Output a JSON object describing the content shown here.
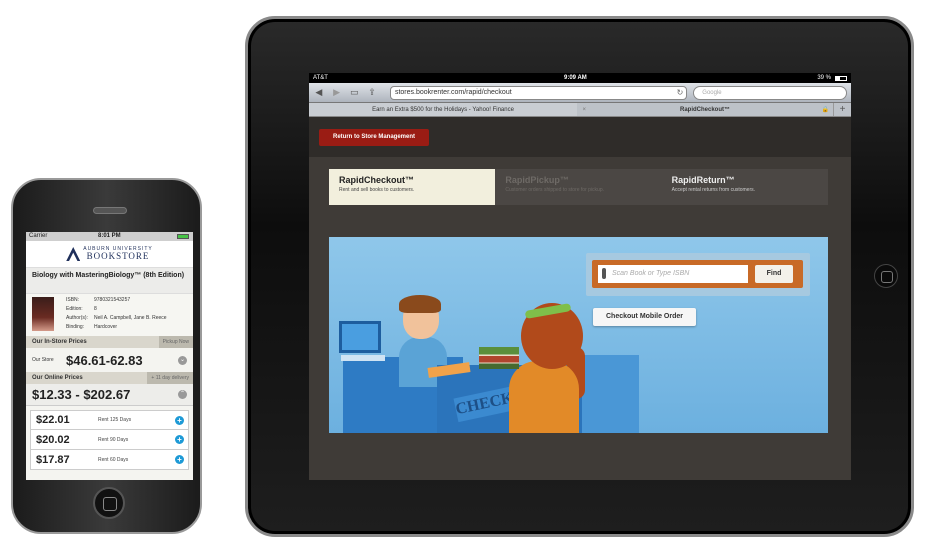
{
  "iphone": {
    "status": {
      "carrier": "Carrier",
      "time": "8:01 PM"
    },
    "logo": {
      "line1": "AUBURN UNIVERSITY",
      "line2": "BOOKSTORE"
    },
    "book_title": "Biology with MasteringBiology™ (8th Edition)",
    "meta": [
      {
        "k": "ISBN:",
        "v": "9780321543257"
      },
      {
        "k": "Edition:",
        "v": "8"
      },
      {
        "k": "Author(s):",
        "v": "Neil A. Campbell, Jane B. Reece"
      },
      {
        "k": "Binding:",
        "v": "Hardcover"
      }
    ],
    "in_store": {
      "header": "Our In-Store Prices",
      "tag": "Pickup Now",
      "label": "Our Store",
      "price": "$46.61-62.83"
    },
    "online": {
      "header": "Our Online Prices",
      "tag": "+ 11 day delivery",
      "price_range": "$12.33 - $202.67"
    },
    "rentals": [
      {
        "price": "$22.01",
        "term": "Rent 125 Days"
      },
      {
        "price": "$20.02",
        "term": "Rent 90 Days"
      },
      {
        "price": "$17.87",
        "term": "Rent 60 Days"
      }
    ]
  },
  "ipad": {
    "status": {
      "carrier": "AT&T",
      "time": "9:09 AM",
      "battery": "39 %"
    },
    "url": "stores.bookrenter.com/rapid/checkout",
    "search_placeholder": "Google",
    "tabs": [
      {
        "label": "Earn an Extra $500 for the Holidays - Yahoo! Finance"
      },
      {
        "label": "RapidCheckout™"
      }
    ],
    "return_button": "Return to Store Management",
    "modes": [
      {
        "title": "RapidCheckout™",
        "subtitle": "Rent and sell books to customers."
      },
      {
        "title": "RapidPickup™",
        "subtitle": "Customer orders shipped to store for pickup."
      },
      {
        "title": "RapidReturn™",
        "subtitle": "Accept rental returns from customers."
      }
    ],
    "scan_placeholder": "Scan Book or Type ISBN",
    "find_button": "Find",
    "mobile_order_button": "Checkout Mobile Order",
    "illustration_text": "CHECKOUT"
  },
  "colors": {
    "accent_red": "#9a1c14",
    "scan_orange": "#c86a27",
    "hero_blue": "#6cb0df",
    "plus_blue": "#1e9ad6"
  }
}
